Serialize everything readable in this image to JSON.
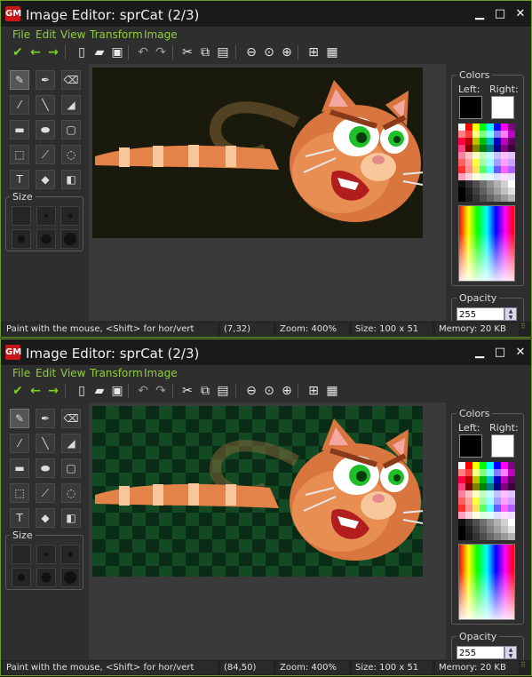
{
  "windows": [
    {
      "title": "Image Editor: sprCat (2/3)",
      "menu": [
        "File",
        "Edit",
        "View",
        "Transform",
        "Image"
      ],
      "background": "dark",
      "status": {
        "hint": "Paint with the mouse, <Shift> for hor/vert",
        "coords": "(7,32)",
        "zoom": "Zoom: 400%",
        "size": "Size: 100 x 51",
        "memory": "Memory: 20 KB"
      }
    },
    {
      "title": "Image Editor: sprCat (2/3)",
      "menu": [
        "File",
        "Edit",
        "View",
        "Transform",
        "Image"
      ],
      "background": "checkerboard",
      "status": {
        "hint": "Paint with the mouse, <Shift> for hor/vert",
        "coords": "(84,50)",
        "zoom": "Zoom: 400%",
        "size": "Size: 100 x 51",
        "memory": "Memory: 20 KB"
      }
    }
  ],
  "window_buttons": {
    "minimize": "▁",
    "maximize": "□",
    "close": "✕"
  },
  "app_icon_text": "GM",
  "toolbar_icons": [
    {
      "name": "confirm-icon",
      "glyph": "✔",
      "style": "green"
    },
    {
      "name": "undo-arrow-icon",
      "glyph": "←",
      "style": "green"
    },
    {
      "name": "redo-arrow-icon",
      "glyph": "→",
      "style": "green"
    },
    {
      "name": "new-icon",
      "glyph": "▯",
      "style": ""
    },
    {
      "name": "open-icon",
      "glyph": "▰",
      "style": ""
    },
    {
      "name": "save-icon",
      "glyph": "▣",
      "style": ""
    },
    {
      "name": "undo-icon",
      "glyph": "↶",
      "style": "gray"
    },
    {
      "name": "redo-icon",
      "glyph": "↷",
      "style": "gray"
    },
    {
      "name": "cut-icon",
      "glyph": "✂",
      "style": ""
    },
    {
      "name": "copy-icon",
      "glyph": "⧉",
      "style": ""
    },
    {
      "name": "paste-icon",
      "glyph": "▤",
      "style": ""
    },
    {
      "name": "zoom-out-icon",
      "glyph": "⊖",
      "style": ""
    },
    {
      "name": "zoom-reset-icon",
      "glyph": "⊙",
      "style": ""
    },
    {
      "name": "zoom-in-icon",
      "glyph": "⊕",
      "style": ""
    },
    {
      "name": "grid-icon",
      "glyph": "⊞",
      "style": ""
    },
    {
      "name": "image-icon",
      "glyph": "▦",
      "style": ""
    }
  ],
  "tools": [
    {
      "name": "pencil-icon",
      "glyph": "✎"
    },
    {
      "name": "spray-icon",
      "glyph": "✒"
    },
    {
      "name": "eraser-icon",
      "glyph": "⌫"
    },
    {
      "name": "color-picker-icon",
      "glyph": "⁄"
    },
    {
      "name": "line-icon",
      "glyph": "╲"
    },
    {
      "name": "polygon-icon",
      "glyph": "◢"
    },
    {
      "name": "rectangle-icon",
      "glyph": "▬"
    },
    {
      "name": "ellipse-icon",
      "glyph": "⬬"
    },
    {
      "name": "rounded-rect-icon",
      "glyph": "▢"
    },
    {
      "name": "select-icon",
      "glyph": "⬚"
    },
    {
      "name": "magic-wand-icon",
      "glyph": "⟋"
    },
    {
      "name": "lasso-icon",
      "glyph": "◌"
    },
    {
      "name": "text-icon",
      "glyph": "T"
    },
    {
      "name": "fill-icon",
      "glyph": "◆"
    },
    {
      "name": "replace-color-icon",
      "glyph": "◧"
    }
  ],
  "size_label": "Size",
  "colors_label": "Colors",
  "left_label": "Left:",
  "right_label": "Right:",
  "left_color": "#000000",
  "right_color": "#ffffff",
  "opacity_label": "Opacity",
  "opacity_value": "255",
  "palette": [
    "#ffffff",
    "#ff0000",
    "#ffff00",
    "#00ff00",
    "#00ffff",
    "#0000ff",
    "#ff00ff",
    "#800080",
    "#ff8080",
    "#ff4040",
    "#ffff80",
    "#80ff80",
    "#80ffff",
    "#8080ff",
    "#ff80ff",
    "#c000c0",
    "#ff0040",
    "#c00000",
    "#c0c000",
    "#00c000",
    "#00c0c0",
    "#0000c0",
    "#c000c0",
    "#600060",
    "#ff4080",
    "#800000",
    "#808000",
    "#008000",
    "#008080",
    "#000080",
    "#800080",
    "#400040",
    "#ff80a0",
    "#ffc0c0",
    "#ffffc0",
    "#c0ffc0",
    "#c0ffff",
    "#c0c0ff",
    "#ffc0ff",
    "#e0c0ff",
    "#ff6060",
    "#ffa0a0",
    "#ffff40",
    "#a0ffa0",
    "#a0ffff",
    "#a0a0ff",
    "#ffa0ff",
    "#d0a0ff",
    "#ff3030",
    "#ff9090",
    "#ffe060",
    "#60ff60",
    "#60ffff",
    "#6060ff",
    "#ff60ff",
    "#b060ff",
    "#ffa0c0",
    "#ffd0e0",
    "#ffffe0",
    "#e0ffe0",
    "#e0ffff",
    "#e0e0ff",
    "#ffe0ff",
    "#f0e0ff",
    "#101010",
    "#303030",
    "#505050",
    "#707070",
    "#909090",
    "#b0b0b0",
    "#d0d0d0",
    "#ffffff",
    "#000000",
    "#202020",
    "#404040",
    "#606060",
    "#808080",
    "#a0a0a0",
    "#c0c0c0",
    "#e0e0e0",
    "#000000",
    "#1a1a1a",
    "#333333",
    "#4d4d4d",
    "#666666",
    "#808080",
    "#999999",
    "#b3b3b3"
  ]
}
